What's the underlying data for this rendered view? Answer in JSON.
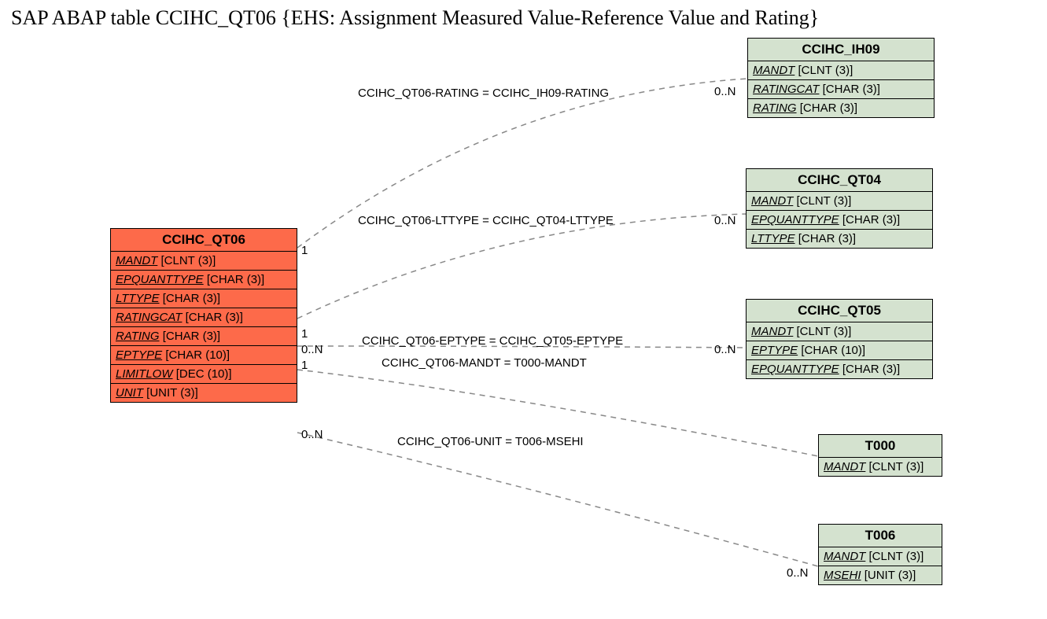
{
  "title": "SAP ABAP table CCIHC_QT06 {EHS: Assignment Measured Value-Reference Value and Rating}",
  "main": {
    "name": "CCIHC_QT06",
    "fields": [
      {
        "f": "MANDT",
        "t": "[CLNT (3)]"
      },
      {
        "f": "EPQUANTTYPE",
        "t": "[CHAR (3)]"
      },
      {
        "f": "LTTYPE",
        "t": "[CHAR (3)]"
      },
      {
        "f": "RATINGCAT",
        "t": "[CHAR (3)]"
      },
      {
        "f": "RATING",
        "t": "[CHAR (3)]"
      },
      {
        "f": "EPTYPE",
        "t": "[CHAR (10)]"
      },
      {
        "f": "LIMITLOW",
        "t": "[DEC (10)]"
      },
      {
        "f": "UNIT",
        "t": "[UNIT (3)]"
      }
    ]
  },
  "rel": [
    {
      "name": "CCIHC_IH09",
      "fields": [
        {
          "f": "MANDT",
          "t": "[CLNT (3)]"
        },
        {
          "f": "RATINGCAT",
          "t": "[CHAR (3)]"
        },
        {
          "f": "RATING",
          "t": "[CHAR (3)]"
        }
      ],
      "edge_label": "CCIHC_QT06-RATING = CCIHC_IH09-RATING",
      "card_l": "1",
      "card_r": "0..N"
    },
    {
      "name": "CCIHC_QT04",
      "fields": [
        {
          "f": "MANDT",
          "t": "[CLNT (3)]"
        },
        {
          "f": "EPQUANTTYPE",
          "t": "[CHAR (3)]"
        },
        {
          "f": "LTTYPE",
          "t": "[CHAR (3)]"
        }
      ],
      "edge_label": "CCIHC_QT06-LTTYPE = CCIHC_QT04-LTTYPE",
      "card_l": "1",
      "card_r": "0..N"
    },
    {
      "name": "CCIHC_QT05",
      "fields": [
        {
          "f": "MANDT",
          "t": "[CLNT (3)]"
        },
        {
          "f": "EPTYPE",
          "t": "[CHAR (10)]"
        },
        {
          "f": "EPQUANTTYPE",
          "t": "[CHAR (3)]"
        }
      ],
      "edge_label": "CCIHC_QT06-EPTYPE = CCIHC_QT05-EPTYPE",
      "card_l": "0..N",
      "card_r": "0..N"
    },
    {
      "name": "T000",
      "fields": [
        {
          "f": "MANDT",
          "t": "[CLNT (3)]"
        }
      ],
      "edge_label": "CCIHC_QT06-MANDT = T000-MANDT",
      "card_l": "1",
      "card_r": ""
    },
    {
      "name": "T006",
      "fields": [
        {
          "f": "MANDT",
          "t": "[CLNT (3)]"
        },
        {
          "f": "MSEHI",
          "t": "[UNIT (3)]"
        }
      ],
      "edge_label": "CCIHC_QT06-UNIT = T006-MSEHI",
      "card_l": "0..N",
      "card_r": "0..N"
    }
  ]
}
